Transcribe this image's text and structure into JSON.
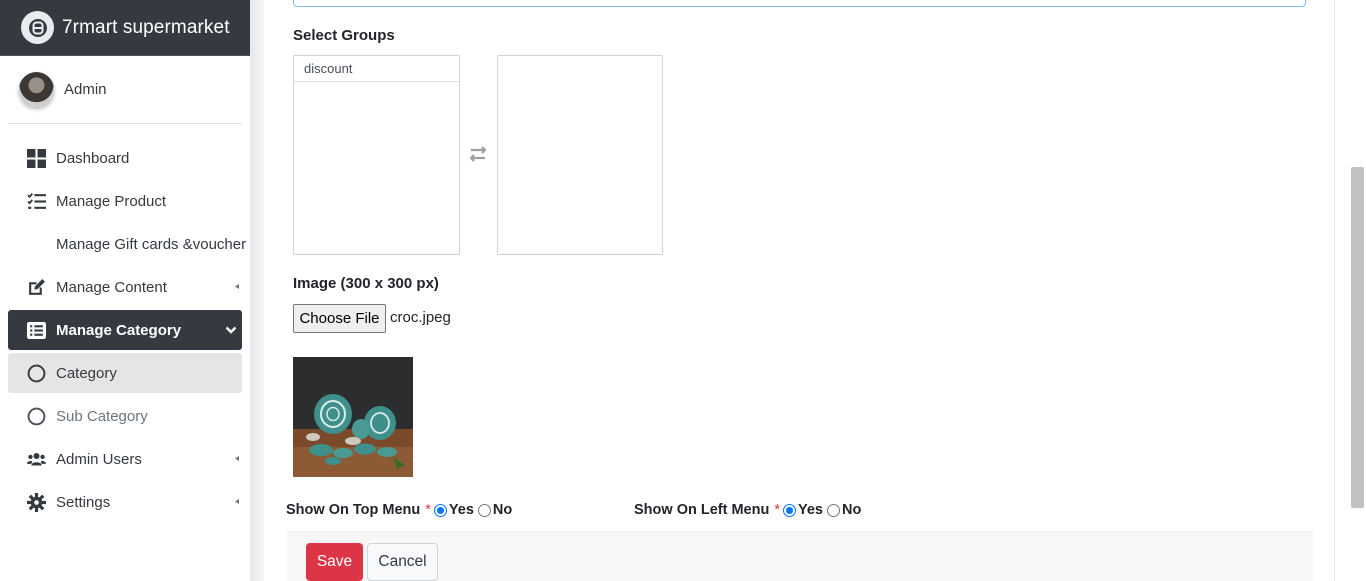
{
  "brand": {
    "name": "7rmart supermarket",
    "icon": "logo-icon"
  },
  "user": {
    "name": "Admin"
  },
  "sidebar": {
    "items": [
      {
        "label": "Dashboard",
        "icon": "dashboard-icon"
      },
      {
        "label": "Manage Product",
        "icon": "list-check-icon"
      },
      {
        "label": "Manage Gift cards &voucher"
      },
      {
        "label": "Manage Content",
        "icon": "edit-icon"
      },
      {
        "label": "Manage Category",
        "icon": "list-icon"
      },
      {
        "label": "Category",
        "icon": "circle-icon"
      },
      {
        "label": "Sub Category",
        "icon": "circle-icon"
      },
      {
        "label": "Admin Users",
        "icon": "users-icon"
      },
      {
        "label": "Settings",
        "icon": "gear-icon"
      }
    ]
  },
  "form": {
    "groups_label": "Select Groups",
    "available_groups": [
      "discount"
    ],
    "selected_groups": [],
    "image_label": "Image (300 x 300 px)",
    "file_button": "Choose File",
    "file_name": "croc.jpeg",
    "top_menu": {
      "label": "Show On Top Menu",
      "required": "*",
      "yes": "Yes",
      "no": "No",
      "value": "Yes"
    },
    "left_menu": {
      "label": "Show On Left Menu",
      "required": "*",
      "yes": "Yes",
      "no": "No",
      "value": "Yes"
    },
    "save_label": "Save",
    "cancel_label": "Cancel"
  },
  "colors": {
    "sidebar_dark": "#343a40",
    "danger": "#dc3545",
    "radio": "#0075ff"
  }
}
